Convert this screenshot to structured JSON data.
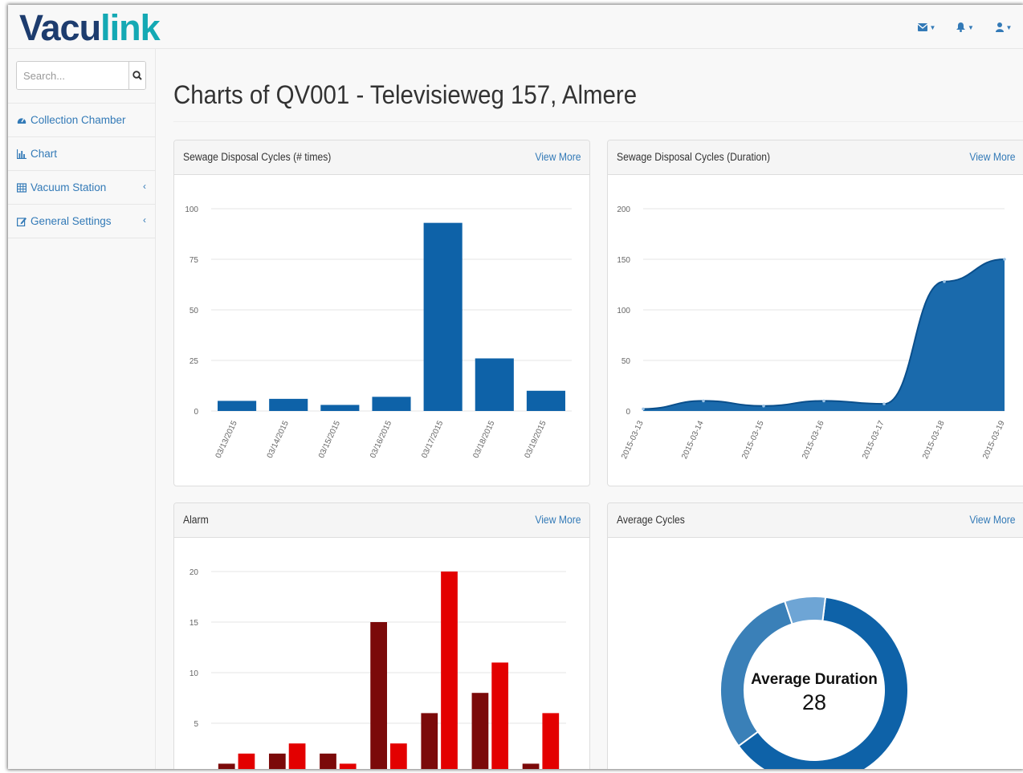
{
  "app": {
    "logo_part1": "Vacu",
    "logo_part2": "link",
    "logo_colors": {
      "part1": "#1d3c6e",
      "part2": "#14a9b4"
    }
  },
  "topnav": {
    "icons": [
      "envelope-icon",
      "bell-icon",
      "user-icon"
    ]
  },
  "sidebar": {
    "search_placeholder": "Search...",
    "items": [
      {
        "label": "Collection Chamber",
        "icon": "dashboard-icon",
        "has_submenu": false
      },
      {
        "label": "Chart",
        "icon": "bar-chart-icon",
        "has_submenu": false
      },
      {
        "label": "Vacuum Station",
        "icon": "table-icon",
        "has_submenu": true
      },
      {
        "label": "General Settings",
        "icon": "edit-icon",
        "has_submenu": true
      }
    ]
  },
  "page": {
    "title": "Charts of QV001 - Televisieweg 157, Almere"
  },
  "panels": {
    "cycles": {
      "title": "Sewage Disposal Cycles (# times)",
      "link": "View More"
    },
    "duration": {
      "title": "Sewage Disposal Cycles (Duration)",
      "link": "View More"
    },
    "alarm": {
      "title": "Alarm",
      "link": "View More"
    },
    "average": {
      "title": "Average Cycles",
      "link": "View More"
    }
  },
  "chart_data": [
    {
      "id": "cycles",
      "type": "bar",
      "categories": [
        "03/13/2015",
        "03/14/2015",
        "03/15/2015",
        "03/16/2015",
        "03/17/2015",
        "03/18/2015",
        "03/19/2015"
      ],
      "values": [
        5,
        6,
        3,
        7,
        93,
        26,
        10
      ],
      "ylim": [
        0,
        100
      ],
      "yticks": [
        0,
        25,
        50,
        75,
        100
      ],
      "grid": true,
      "color": "#0e62a8"
    },
    {
      "id": "duration",
      "type": "area",
      "x": [
        "2015-03-13",
        "2015-03-14",
        "2015-03-15",
        "2015-03-16",
        "2015-03-17",
        "2015-03-18",
        "2015-03-19"
      ],
      "values": [
        2,
        10,
        5,
        10,
        7,
        128,
        150
      ],
      "ylim": [
        0,
        200
      ],
      "yticks": [
        0,
        50,
        100,
        150,
        200
      ],
      "grid": true,
      "color": "#0e62a8"
    },
    {
      "id": "alarm",
      "type": "bar",
      "series": [
        {
          "values": [
            1,
            2,
            2,
            15,
            6,
            8,
            1
          ],
          "color": "#7b0a0a"
        },
        {
          "values": [
            2,
            3,
            1,
            3,
            20,
            11,
            6
          ],
          "color": "#e30000"
        }
      ],
      "ylim": [
        0,
        20
      ],
      "yticks": [
        0,
        5,
        10,
        15,
        20
      ],
      "grid": true
    },
    {
      "id": "average",
      "type": "pie",
      "title": "Average Duration",
      "center_value": "28",
      "slices": [
        {
          "value": 63,
          "color": "#0e62a8"
        },
        {
          "value": 30,
          "color": "#3a80b8"
        },
        {
          "value": 7,
          "color": "#6ea5d5"
        }
      ]
    }
  ]
}
